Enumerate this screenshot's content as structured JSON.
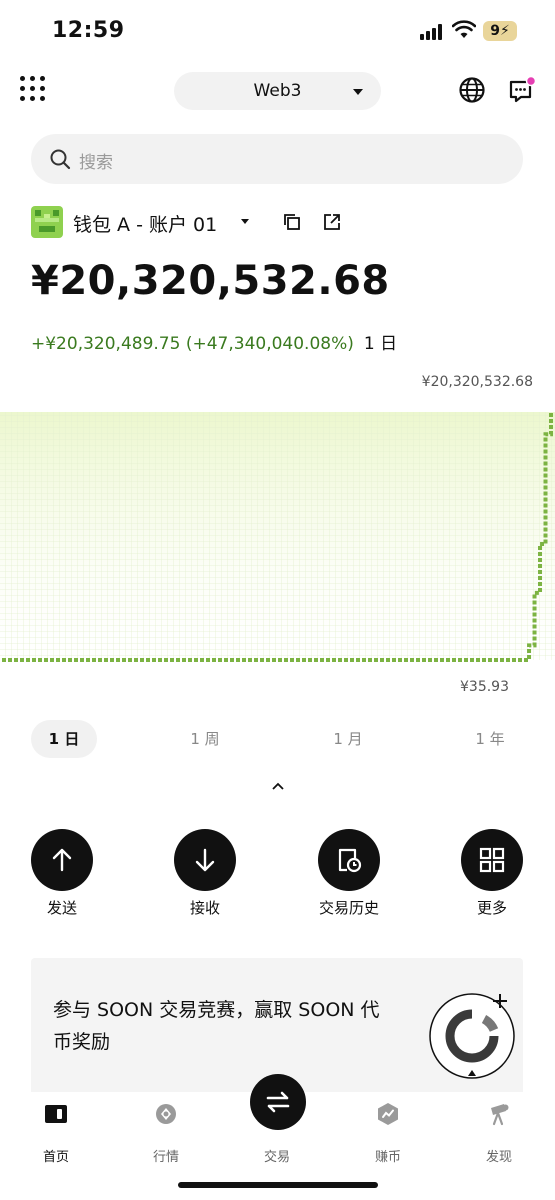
{
  "status_bar": {
    "time": "12:59",
    "battery": "9"
  },
  "top_nav": {
    "network_selector": "Web3"
  },
  "search": {
    "placeholder": "搜索"
  },
  "wallet": {
    "name": "钱包 A - 账户 01",
    "balance": "¥20,320,532.68",
    "change_value": "+¥20,320,489.75 (+47,340,040.08%)",
    "change_period": "1 日"
  },
  "chart_data": {
    "type": "area",
    "max_label": "¥20,320,532.68",
    "min_label": "¥35.93",
    "x": [
      0,
      0.2,
      0.4,
      0.6,
      0.8,
      0.95,
      0.96,
      0.97,
      0.98,
      0.99,
      1.0
    ],
    "values": [
      35.93,
      35.93,
      35.93,
      35.93,
      35.93,
      35.93,
      1200000,
      5500000,
      9500000,
      18500000,
      20320532.68
    ],
    "ylim": [
      35.93,
      20320532.68
    ],
    "colors": {
      "line": "#7cb342",
      "fill": "#eaf6c8",
      "grid": "#e4f0cf"
    }
  },
  "time_range": {
    "selected": "1 日",
    "options": [
      "1 日",
      "1 周",
      "1 月",
      "1 年"
    ]
  },
  "actions": [
    {
      "label": "发送",
      "icon": "arrow-up-icon"
    },
    {
      "label": "接收",
      "icon": "arrow-down-icon"
    },
    {
      "label": "交易历史",
      "icon": "history-icon"
    },
    {
      "label": "更多",
      "icon": "grid-icon"
    }
  ],
  "promo": {
    "text": "参与 SOON 交易竞赛，赢取 SOON 代币奖励"
  },
  "bottom_nav": [
    {
      "label": "首页",
      "icon": "wallet-icon",
      "active": true
    },
    {
      "label": "行情",
      "icon": "market-icon",
      "active": false
    },
    {
      "label": "交易",
      "icon": "swap-icon",
      "active": false
    },
    {
      "label": "赚币",
      "icon": "earn-icon",
      "active": false
    },
    {
      "label": "发现",
      "icon": "discover-icon",
      "active": false
    }
  ],
  "colors": {
    "accent": "#111111",
    "positive": "#3a7a1f",
    "notification": "#e63fb3"
  }
}
